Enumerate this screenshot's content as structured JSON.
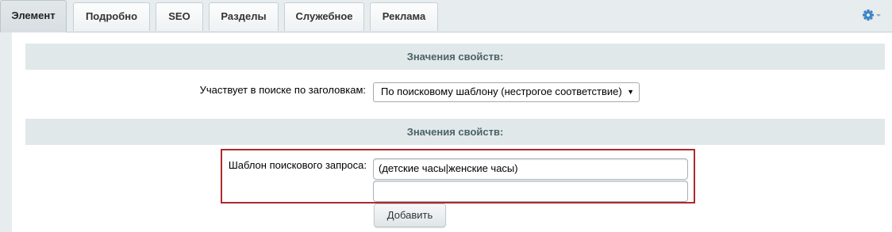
{
  "tabs": [
    {
      "label": "Элемент",
      "active": true
    },
    {
      "label": "Подробно",
      "active": false
    },
    {
      "label": "SEO",
      "active": false
    },
    {
      "label": "Разделы",
      "active": false
    },
    {
      "label": "Служебное",
      "active": false
    },
    {
      "label": "Реклама",
      "active": false
    }
  ],
  "settings_icon": "gear-icon",
  "accent_color": "#3d86c6",
  "highlight_color": "#b0282c",
  "sections": [
    {
      "header": "Значения свойств:"
    },
    {
      "header": "Значения свойств:"
    }
  ],
  "search_by_titles": {
    "label": "Участвует в поиске по заголовкам:",
    "selected": "По поисковому шаблону (нестрогое соответствие)"
  },
  "search_template": {
    "label": "Шаблон поискового запроса:",
    "values": [
      "(детские часы|женские часы)",
      ""
    ],
    "add_label": "Добавить"
  }
}
